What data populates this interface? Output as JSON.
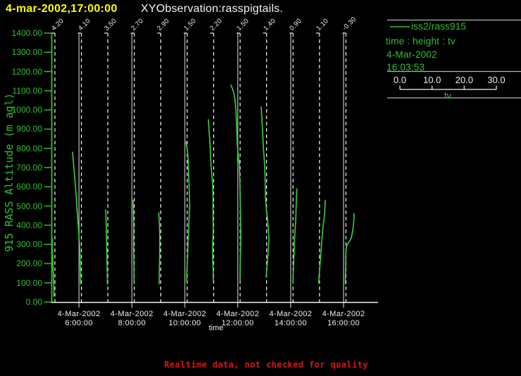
{
  "header": {
    "datetime": "4-mar-2002,17:00:00",
    "title": "XYObservation:rasspigtails."
  },
  "y_axis": {
    "label": "915 RASS Altitude (m agl)",
    "tick_labels": [
      "0.00",
      "100.00",
      "200.00",
      "300.00",
      "400.00",
      "500.00",
      "600.00",
      "700.00",
      "800.00",
      "900.00",
      "1000.00",
      "1100.00",
      "1200.00",
      "1300.00",
      "1400.00"
    ]
  },
  "x_axis": {
    "label": "time",
    "ticks": [
      {
        "date": "4-Mar-2002",
        "time": "6:00:00"
      },
      {
        "date": "4-Mar-2002",
        "time": "8:00:00"
      },
      {
        "date": "4-Mar-2002",
        "time": "10:00:00"
      },
      {
        "date": "4-Mar-2002",
        "time": "12:00:00"
      },
      {
        "date": "4-Mar-2002",
        "time": "14:00:00"
      },
      {
        "date": "4-Mar-2002",
        "time": "16:00:00"
      }
    ]
  },
  "legend": {
    "series": "iss2/rass915",
    "subtitle": "time : height : tv",
    "date": "4-Mar-2002",
    "time": "16:03:53",
    "tv_label": "tv",
    "tv_tick_labels": [
      "0.0",
      "10.0",
      "20.0",
      "30.0"
    ]
  },
  "notice": {
    "text": "Realtime data, not checked for quality"
  },
  "colors": {
    "background": "#000000",
    "green": "#2ec22e",
    "curve_green": "#3bd33b",
    "yellow": "#ffff00",
    "white": "#f5f5f5",
    "grid_gray": "#9b9b9b",
    "rule_gray": "#b5b5b5",
    "red": "#de1414"
  },
  "chart_data": {
    "type": "line",
    "title": "XYObservation:rasspigtails.",
    "xlabel": "time",
    "ylabel": "915 RASS Altitude (m agl)",
    "ylim": [
      0,
      1400
    ],
    "y_tick_step": 100,
    "legend_position": "right",
    "tv_axis": {
      "ticks": [
        0.0,
        10.0,
        20.0,
        30.0
      ],
      "label": "tv"
    },
    "profiles": [
      {
        "time": "5:00",
        "top_label": "4.20",
        "points": [
          [
            330,
            -3.5
          ],
          [
            290,
            -4
          ],
          [
            250,
            -3.5
          ],
          [
            205,
            -3
          ],
          [
            160,
            -2.5
          ],
          [
            120,
            -2
          ],
          [
            75,
            -1.5
          ],
          [
            30,
            -1.5
          ]
        ]
      },
      {
        "time": "6:00",
        "top_label": "4.10",
        "points": [
          [
            780,
            -12.5
          ],
          [
            735,
            -11.5
          ],
          [
            690,
            -10.5
          ],
          [
            650,
            -9.5
          ],
          [
            605,
            -8.5
          ],
          [
            555,
            -7.5
          ],
          [
            500,
            -6.5
          ],
          [
            450,
            -5.5
          ],
          [
            400,
            -4.5
          ],
          [
            350,
            -3.5
          ],
          [
            295,
            -2.5
          ],
          [
            245,
            -2
          ],
          [
            195,
            -1.6
          ],
          [
            145,
            -1.3
          ],
          [
            95,
            -1.1
          ]
        ]
      },
      {
        "time": "7:00",
        "top_label": "3.50",
        "points": [
          [
            480,
            -3.2
          ],
          [
            440,
            -2.7
          ],
          [
            400,
            -2.3
          ],
          [
            350,
            -2
          ],
          [
            300,
            -1.7
          ],
          [
            250,
            -1.4
          ],
          [
            200,
            -1.2
          ],
          [
            150,
            -0.9
          ],
          [
            95,
            -0.7
          ]
        ]
      },
      {
        "time": "8:00",
        "top_label": "2.70",
        "points": [
          [
            530,
            -1.8
          ],
          [
            480,
            -1.3
          ],
          [
            430,
            -1
          ],
          [
            380,
            -0.8
          ],
          [
            330,
            -1
          ],
          [
            280,
            -0.9
          ],
          [
            230,
            -0.7
          ],
          [
            180,
            -0.5
          ],
          [
            130,
            -0.4
          ],
          [
            95,
            -0.3
          ]
        ]
      },
      {
        "time": "9:00",
        "top_label": "2.90",
        "points": [
          [
            465,
            -2.8
          ],
          [
            420,
            -2.1
          ],
          [
            370,
            -1.6
          ],
          [
            320,
            -1.4
          ],
          [
            270,
            -1.5
          ],
          [
            220,
            -1.7
          ],
          [
            170,
            -2
          ],
          [
            130,
            -2.2
          ],
          [
            95,
            -2.3
          ]
        ]
      },
      {
        "time": "10:00",
        "top_label": "1.50",
        "points": [
          [
            835,
            -1.9
          ],
          [
            795,
            0.1
          ],
          [
            750,
            1.1
          ],
          [
            700,
            1.6
          ],
          [
            655,
            2.1
          ],
          [
            610,
            2.6
          ],
          [
            555,
            3.1
          ],
          [
            500,
            3.6
          ],
          [
            435,
            2.6
          ],
          [
            365,
            2.1
          ],
          [
            315,
            1.1
          ],
          [
            255,
            0.8
          ],
          [
            200,
            0.1
          ],
          [
            150,
            -0.6
          ],
          [
            105,
            -0.6
          ]
        ]
      },
      {
        "time": "11:00",
        "top_label": "2.20",
        "points": [
          [
            950,
            -7.5
          ],
          [
            885,
            -6.5
          ],
          [
            840,
            -5.5
          ],
          [
            760,
            -4.5
          ],
          [
            700,
            -3.5
          ],
          [
            655,
            -2.5
          ],
          [
            610,
            -1.5
          ],
          [
            555,
            -1
          ],
          [
            475,
            -1
          ],
          [
            365,
            -0.7
          ],
          [
            295,
            -1.5
          ],
          [
            235,
            -1.5
          ],
          [
            160,
            -0.7
          ],
          [
            105,
            -0.5
          ]
        ]
      },
      {
        "time": "12:00",
        "top_label": "1.50",
        "points": [
          [
            1130,
            -13
          ],
          [
            1110,
            -11
          ],
          [
            1090,
            -9
          ],
          [
            1045,
            -7
          ],
          [
            995,
            -6
          ],
          [
            915,
            -5
          ],
          [
            815,
            -4
          ],
          [
            765,
            -2.6
          ],
          [
            710,
            -1.1
          ],
          [
            640,
            -0.6
          ],
          [
            570,
            -0.1
          ],
          [
            475,
            0.4
          ],
          [
            350,
            0.9
          ],
          [
            255,
            0.4
          ],
          [
            180,
            -0.1
          ],
          [
            115,
            -0.1
          ]
        ]
      },
      {
        "time": "13:00",
        "top_label": "1.40",
        "points": [
          [
            1015,
            -7.6
          ],
          [
            955,
            -6.6
          ],
          [
            885,
            -5.6
          ],
          [
            810,
            -4.6
          ],
          [
            735,
            -3.1
          ],
          [
            655,
            -2.1
          ],
          [
            545,
            -1.6
          ],
          [
            475,
            -0.1
          ],
          [
            435,
            1.4
          ],
          [
            380,
            2.4
          ],
          [
            325,
            3.4
          ],
          [
            270,
            2.4
          ],
          [
            215,
            1.4
          ],
          [
            170,
            0.4
          ],
          [
            130,
            -0.6
          ]
        ]
      },
      {
        "time": "14:00",
        "top_label": "0.90",
        "points": [
          [
            590,
            5.5
          ],
          [
            535,
            4.8
          ],
          [
            480,
            4.3
          ],
          [
            425,
            3.8
          ],
          [
            365,
            2.8
          ],
          [
            300,
            1.8
          ],
          [
            245,
            1.3
          ],
          [
            190,
            0.8
          ],
          [
            145,
            0.3
          ],
          [
            100,
            -0.2
          ]
        ]
      },
      {
        "time": "15:00",
        "top_label": "1.10",
        "points": [
          [
            530,
            8.2
          ],
          [
            500,
            7.9
          ],
          [
            445,
            6.9
          ],
          [
            400,
            5.2
          ],
          [
            355,
            4.2
          ],
          [
            315,
            3.2
          ],
          [
            265,
            2.2
          ],
          [
            215,
            1.2
          ],
          [
            170,
            0.2
          ],
          [
            135,
            -0.6
          ],
          [
            100,
            -1
          ]
        ]
      },
      {
        "time": "16:00",
        "top_label": "-0.30",
        "points": [
          [
            460,
            11.6
          ],
          [
            430,
            11.3
          ],
          [
            390,
            10.3
          ],
          [
            365,
            9.3
          ],
          [
            335,
            7.6
          ],
          [
            320,
            5.6
          ],
          [
            310,
            3.6
          ],
          [
            295,
            1.3
          ],
          [
            280,
            0.3
          ],
          [
            235,
            -0.4
          ],
          [
            180,
            -0.4
          ],
          [
            125,
            -0.8
          ],
          [
            95,
            -0.8
          ]
        ]
      }
    ]
  }
}
